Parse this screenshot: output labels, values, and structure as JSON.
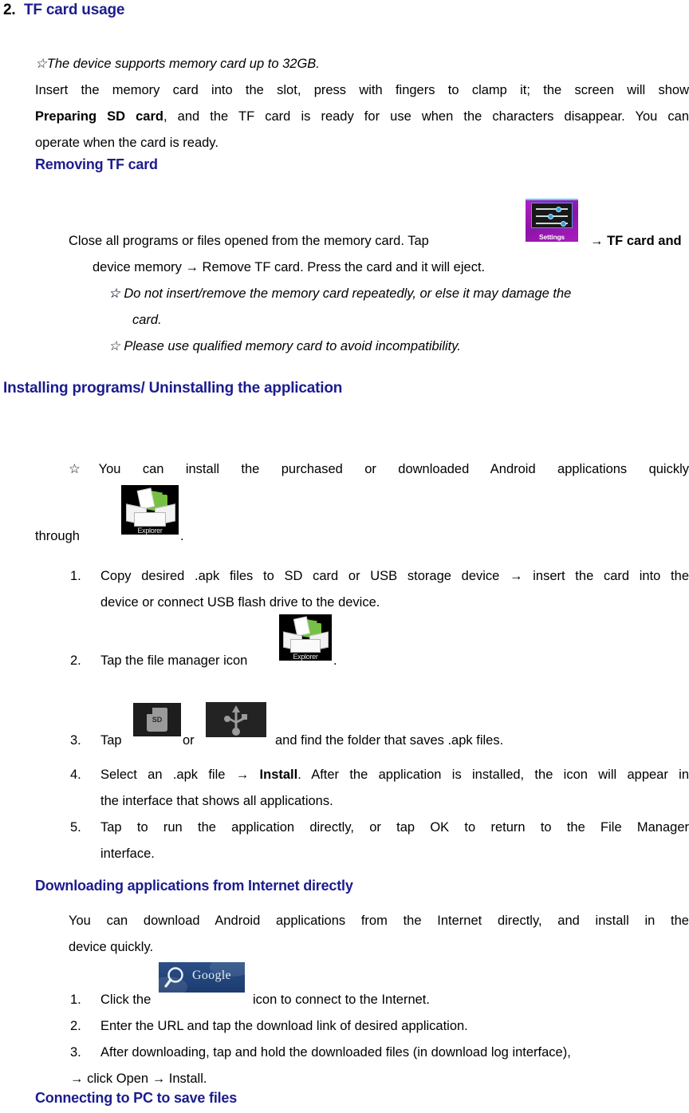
{
  "document": {
    "section_number": "2.",
    "section_title": "TF card usage",
    "notes": {
      "memory_card_note": "☆The device supports memory card up to 32GB.",
      "insert_line1": "Insert the memory card into the slot, press with fingers to clamp it; the screen will show",
      "insert_bold": "Preparing SD card",
      "insert_line2_a": ", and the TF card is ready for use when the characters disappear. You can",
      "insert_line3": "operate when the card is ready."
    },
    "removing_heading": "Removing TF card",
    "removing": {
      "line1_before_icon": "Close all programs or files opened from the memory card. Tap",
      "line1_after_icon": "→ TF card and",
      "line2": "device memory → Remove TF card. Press the card and it will eject.",
      "warn1": "☆ Do not insert/remove the memory card repeatedly, or else it may damage the",
      "warn1_cont": "card.",
      "warn2": "☆ Please use qualified memory card to avoid incompatibility."
    },
    "installing_heading": "Installing programs/ Uninstalling the application",
    "installing": {
      "intro_line1": "☆You  can  install  the  purchased  or  downloaded  Android  applications  quickly",
      "intro_line2_before_icon": "through",
      "intro_line2_after_icon": ".",
      "steps": [
        {
          "number": "1.",
          "text_line1": "Copy desired .apk files to SD card or USB storage device → insert the card into the",
          "text_line2": "device or connect USB flash drive to the device."
        },
        {
          "number": "2.",
          "text_before_icon": "Tap the file manager icon",
          "text_after_icon": "."
        },
        {
          "number": "3.",
          "text_before_icon": "Tap",
          "text_between_icons": "or",
          "text_after_icon": "and find the folder that saves .apk files."
        },
        {
          "number": "4.",
          "text_before_bold": "Select an .apk file → ",
          "bold": "Install",
          "text_after_bold": ". After the application is installed, the icon will appear in",
          "text_line2": "the interface that shows all applications."
        },
        {
          "number": "5.",
          "text_line1": "Tap  to  run  the  application  directly,  or  tap  OK  to  return  to  the  File  Manager",
          "text_line2": "interface."
        }
      ]
    },
    "downloading_heading": "Downloading applications from Internet directly",
    "downloading": {
      "intro_line1": "You  can  download  Android  applications  from  the  Internet  directly,  and  install  in  the",
      "intro_line2": "device quickly.",
      "steps": [
        {
          "number": "1.",
          "text_before_icon": "Click the",
          "text_after_icon": "icon to connect to the Internet."
        },
        {
          "number": "2.",
          "text": "Enter the URL and tap the download link of desired application."
        },
        {
          "number": "3.",
          "text_line1": "After downloading, tap and hold the downloaded files (in download log interface),",
          "text_line2": "→ click Open → Install."
        }
      ]
    },
    "connecting_heading": "Connecting to PC to save files"
  },
  "icons": {
    "settings": {
      "name": "settings-icon",
      "label": "Settings"
    },
    "explorer": {
      "name": "explorer-icon",
      "label": "Explorer"
    },
    "sd_card": {
      "name": "sd-card-icon",
      "label": "SD"
    },
    "usb": {
      "name": "usb-icon",
      "label": "USB"
    },
    "google_search": {
      "name": "google-search-icon",
      "label": "Google"
    }
  },
  "colors": {
    "heading_blue": "#1c1c8f",
    "body_black": "#000000",
    "star_blue": "#2222a0",
    "settings_tile": "#a81cbe",
    "explorer_tile": "#000000",
    "google_tile": "#23477e"
  }
}
